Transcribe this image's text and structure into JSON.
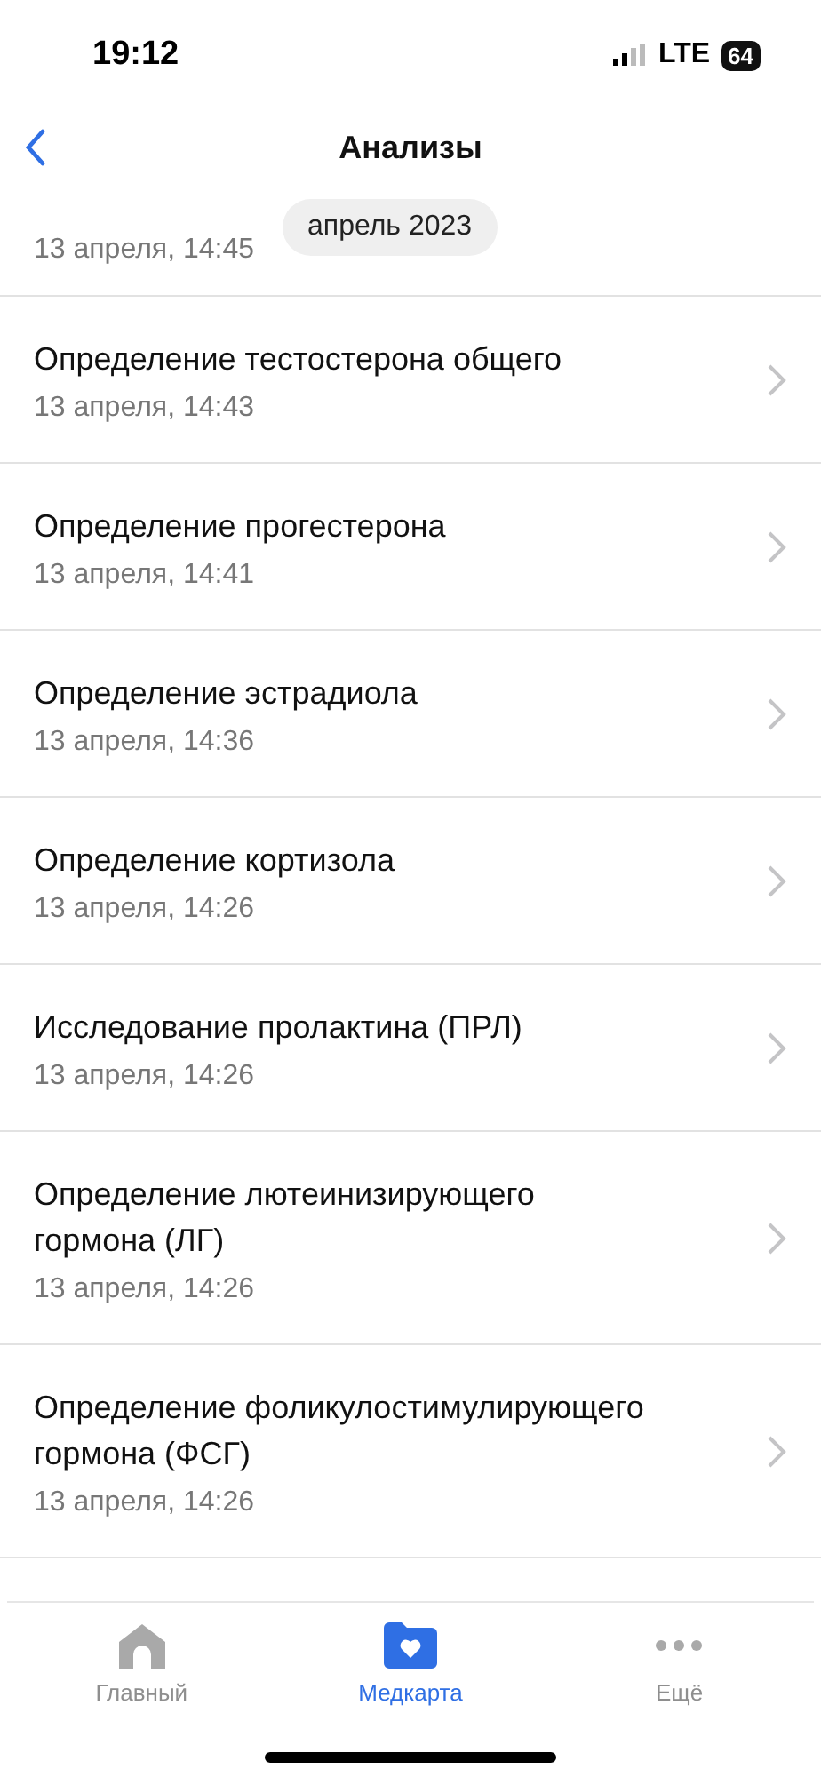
{
  "status_bar": {
    "time": "19:12",
    "network": "LTE",
    "battery": "64"
  },
  "header": {
    "title": "Анализы"
  },
  "month_pill": "апрель 2023",
  "partial_item": {
    "date": "13 апреля, 14:45"
  },
  "items": [
    {
      "title": "Определение тестостерона общего",
      "date": "13 апреля, 14:43"
    },
    {
      "title": "Определение прогестерона",
      "date": "13 апреля, 14:41"
    },
    {
      "title": "Определение эстрадиола",
      "date": "13 апреля, 14:36"
    },
    {
      "title": "Определение кортизола",
      "date": "13 апреля, 14:26"
    },
    {
      "title": "Исследование пролактина (ПРЛ)",
      "date": "13 апреля, 14:26"
    },
    {
      "title": "Определение лютеинизирующего гормона (ЛГ)",
      "date": "13 апреля, 14:26"
    },
    {
      "title": "Определение фоликулостимулирующего гормона (ФСГ)",
      "date": "13 апреля, 14:26"
    }
  ],
  "tabs": [
    {
      "kind": "home",
      "label": "Главный",
      "selected": false
    },
    {
      "kind": "medcard",
      "label": "Медкарта",
      "selected": true
    },
    {
      "kind": "more",
      "label": "Ещё",
      "selected": false
    }
  ]
}
